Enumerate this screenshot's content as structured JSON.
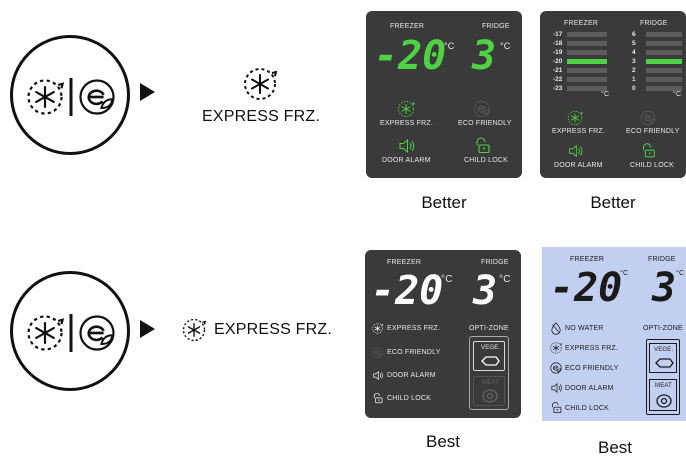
{
  "rows": [
    {
      "express_label": "EXPRESS FRZ.",
      "panels": [
        {
          "style": "dark",
          "freezer_label": "FREEZER",
          "fridge_label": "FRIDGE",
          "freezer_temp": "-20",
          "fridge_temp": "3",
          "unit": "°C",
          "temp_color": "#4fd146",
          "buttons": [
            "EXPRESS FRZ.",
            "ECO FRIENDLY",
            "DOOR ALARM",
            "CHILD LOCK"
          ],
          "caption": "Better"
        },
        {
          "style": "dark",
          "freezer_label": "FREEZER",
          "fridge_label": "FRIDGE",
          "freezer_scale": [
            "-17",
            "-18",
            "-19",
            "-20",
            "-21",
            "-22",
            "-23"
          ],
          "fridge_scale": [
            "6",
            "5",
            "4",
            "3",
            "2",
            "1",
            "0"
          ],
          "freezer_selected": "-20",
          "fridge_selected": "3",
          "unit": "°C",
          "buttons": [
            "EXPRESS FRZ.",
            "ECO FRIENDLY",
            "DOOR ALARM",
            "CHILD LOCK"
          ],
          "caption": "Better"
        }
      ]
    },
    {
      "express_label": "EXPRESS FRZ.",
      "panels": [
        {
          "style": "dark",
          "freezer_label": "FREEZER",
          "fridge_label": "FRIDGE",
          "freezer_temp": "-20",
          "fridge_temp": "3",
          "unit": "°C",
          "temp_color": "#ffffff",
          "buttons": [
            "EXPRESS FRZ.",
            "ECO FRIENDLY",
            "DOOR ALARM",
            "CHILD LOCK"
          ],
          "zone_label": "OPTI-ZONE",
          "zone_items": [
            "VEGE.",
            "MEAT"
          ],
          "caption": "Best"
        },
        {
          "style": "light",
          "freezer_label": "FREEZER",
          "fridge_label": "FRIDGE",
          "freezer_temp": "-20",
          "fridge_temp": "3",
          "unit": "°C",
          "temp_color": "#1a1a1a",
          "buttons": [
            "NO WATER",
            "EXPRESS FRZ.",
            "ECO FRIENDLY",
            "DOOR ALARM",
            "CHILD LOCK"
          ],
          "zone_label": "OPTI-ZONE",
          "zone_items": [
            "VEGE.",
            "MEAT"
          ],
          "caption": "Best"
        }
      ]
    }
  ],
  "colors": {
    "led_green": "#4fd146",
    "dark_panel": "#3a3a3a",
    "light_panel": "#c3cff0"
  }
}
